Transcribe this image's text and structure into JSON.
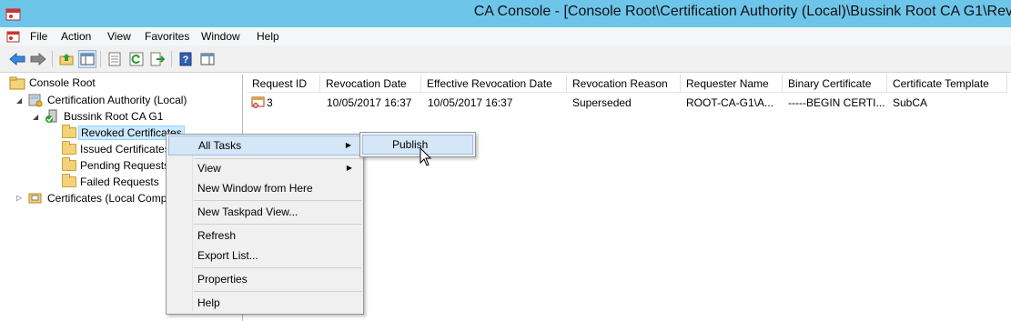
{
  "window": {
    "title": "CA Console - [Console Root\\Certification Authority (Local)\\Bussink Root CA G1\\Rev"
  },
  "menu": [
    "File",
    "Action",
    "View",
    "Favorites",
    "Window",
    "Help"
  ],
  "toolbar": {
    "buttons": [
      "back-arrow-icon",
      "forward-arrow-icon",
      "up-folder-icon",
      "show-hide-tree-icon",
      "properties-icon",
      "refresh-icon",
      "export-list-icon",
      "help-icon",
      "show-hide-action-pane-icon"
    ]
  },
  "tree": {
    "items": [
      {
        "label": "Console Root",
        "icon": "console-root-folder-icon"
      },
      {
        "label": "Certification Authority (Local)",
        "icon": "certification-authority-icon"
      },
      {
        "label": "Bussink Root CA G1",
        "icon": "ca-server-check-icon"
      },
      {
        "label": "Revoked Certificates",
        "icon": "folder-icon"
      },
      {
        "label": "Issued Certificates",
        "icon": "folder-icon"
      },
      {
        "label": "Pending Requests",
        "icon": "folder-icon"
      },
      {
        "label": "Failed Requests",
        "icon": "folder-icon"
      },
      {
        "label": "Certificates (Local Computer)",
        "icon": "certificates-store-icon"
      }
    ]
  },
  "table": {
    "columns": [
      "Request ID",
      "Revocation Date",
      "Effective Revocation Date",
      "Revocation Reason",
      "Requester Name",
      "Binary Certificate",
      "Certificate Template"
    ],
    "rows": [
      [
        "3",
        "10/05/2017 16:37",
        "10/05/2017 16:37",
        "Superseded",
        "ROOT-CA-G1\\A...",
        "-----BEGIN CERTI...",
        "SubCA"
      ]
    ]
  },
  "context_menu": {
    "items": [
      "All Tasks",
      "View",
      "New Window from Here",
      "New Taskpad View...",
      "Refresh",
      "Export List...",
      "Properties",
      "Help"
    ]
  },
  "submenu": {
    "items": [
      "Publish"
    ]
  },
  "colors": {
    "titlebar": "#6ec5ea",
    "highlight": "#d5e6f7",
    "selection": "#cce8ff"
  }
}
